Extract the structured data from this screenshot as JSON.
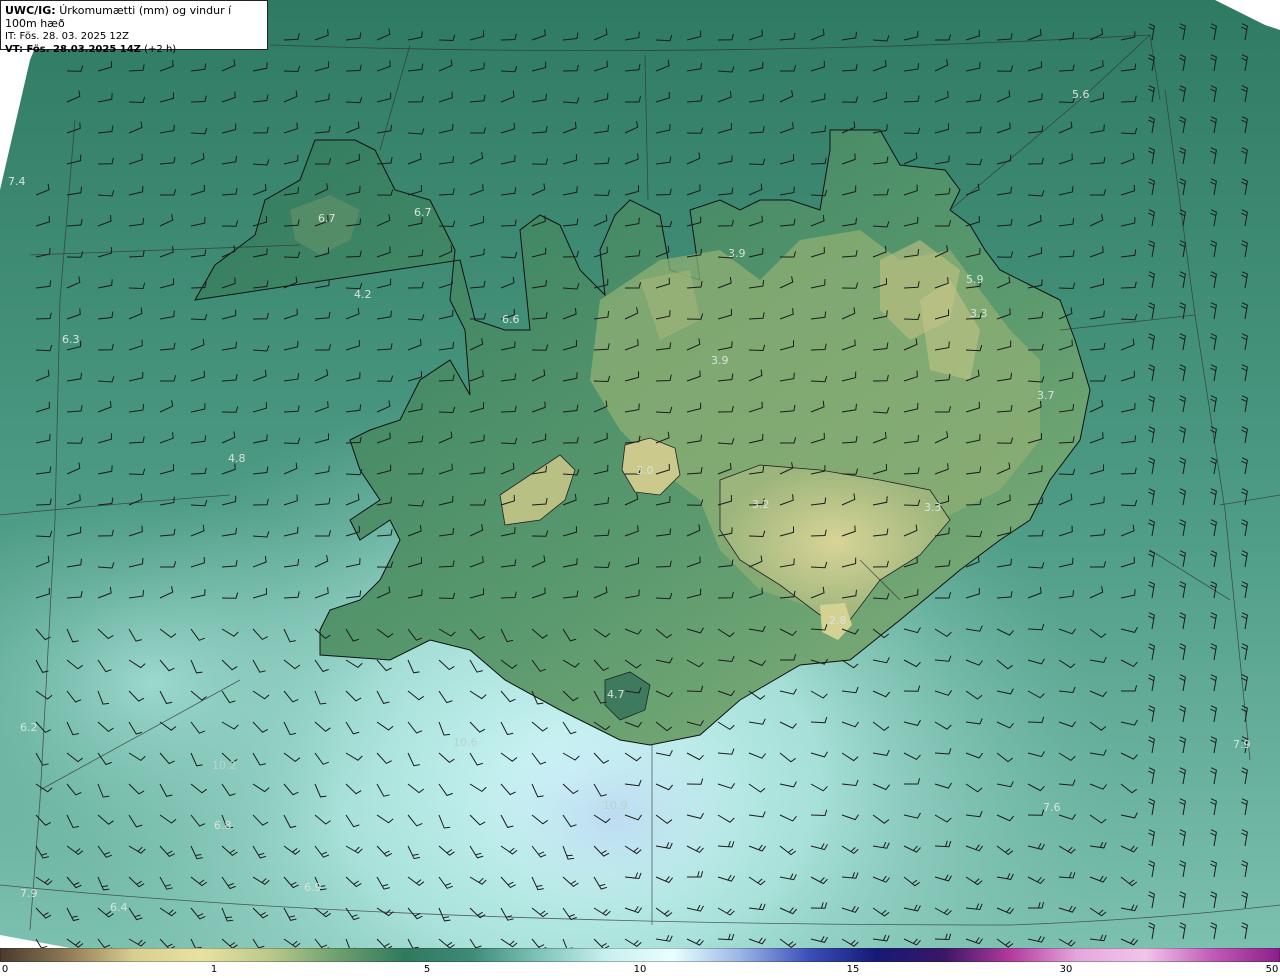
{
  "header": {
    "model_label": "UWC/IG:",
    "title": "Úrkomumætti (mm) og vindur í 100m hæð",
    "it_line": "IT: Fös. 28. 03. 2025 12Z",
    "vt_label": "VT: Fös. 28.03.2025 14Z",
    "vt_offset": "(+2 h)"
  },
  "map_labels": [
    "7.4",
    "6.7",
    "6.7",
    "4.2",
    "6.3",
    "6.6",
    "3.9",
    "3.9",
    "5.9",
    "3.3",
    "3.7",
    "5.6",
    "4.8",
    "3.0",
    "3.2",
    "3.3",
    "2.8",
    "4.7",
    "6.2",
    "10.6",
    "10.2",
    "10.9",
    "6.8",
    "7.6",
    "7.9",
    "6.9",
    "6.4",
    "7.9"
  ],
  "colorbar": {
    "ticks": [
      "0",
      "1",
      "5",
      "10",
      "15",
      "30",
      "50"
    ],
    "colors": [
      "#4a3a2e",
      "#8f7b56",
      "#d9cf90",
      "#e8e2a0",
      "#b9c98a",
      "#6fa06e",
      "#2f7a5e",
      "#3e8a78",
      "#7ec4b8",
      "#c8f0ee",
      "#e8ffff",
      "#9ab4e6",
      "#3b4fb8",
      "#141a78",
      "#3a1668",
      "#b23a9c",
      "#e4a8dc",
      "#f2c4ea",
      "#c05cb8",
      "#8a1e8a"
    ]
  },
  "colors": {
    "ocean_dark": "#3c8a74",
    "ocean_light": "#b8ece6",
    "land_low": "#2f7a5e",
    "land_high": "#c9cc8a",
    "barb": "#202020"
  }
}
